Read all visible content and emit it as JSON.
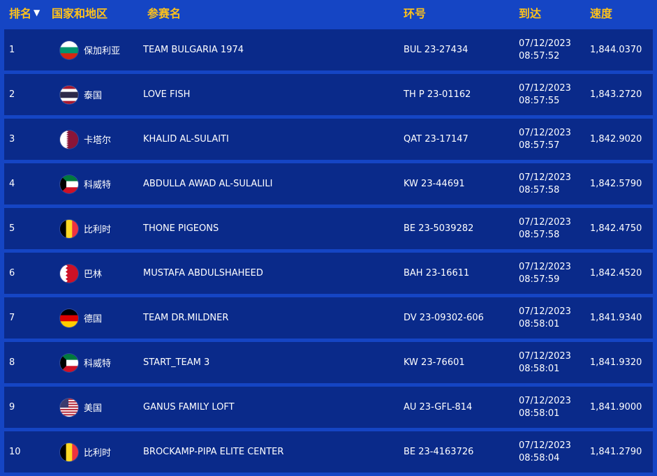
{
  "headers": {
    "rank": "排名",
    "country": "国家和地区",
    "name": "参赛名",
    "ring": "环号",
    "arrival": "到达",
    "speed": "速度"
  },
  "rows": [
    {
      "rank": "1",
      "country": "保加利亚",
      "flag": "bulgaria-flag-icon",
      "name": "TEAM BULGARIA 1974",
      "ring": "BUL 23-27434",
      "date": "07/12/2023",
      "time": "08:57:52",
      "speed": "1,844.0370"
    },
    {
      "rank": "2",
      "country": "泰国",
      "flag": "thailand-flag-icon",
      "name": "LOVE FISH",
      "ring": "TH P 23-01162",
      "date": "07/12/2023",
      "time": "08:57:55",
      "speed": "1,843.2720"
    },
    {
      "rank": "3",
      "country": "卡塔尔",
      "flag": "qatar-flag-icon",
      "name": "KHALID AL-SULAITI",
      "ring": "QAT 23-17147",
      "date": "07/12/2023",
      "time": "08:57:57",
      "speed": "1,842.9020"
    },
    {
      "rank": "4",
      "country": "科威特",
      "flag": "kuwait-flag-icon",
      "name": "ABDULLA AWAD AL-SULALILI",
      "ring": "KW 23-44691",
      "date": "07/12/2023",
      "time": "08:57:58",
      "speed": "1,842.5790"
    },
    {
      "rank": "5",
      "country": "比利时",
      "flag": "belgium-flag-icon",
      "name": "THONE PIGEONS",
      "ring": "BE 23-5039282",
      "date": "07/12/2023",
      "time": "08:57:58",
      "speed": "1,842.4750"
    },
    {
      "rank": "6",
      "country": "巴林",
      "flag": "bahrain-flag-icon",
      "name": "MUSTAFA ABDULSHAHEED",
      "ring": "BAH 23-16611",
      "date": "07/12/2023",
      "time": "08:57:59",
      "speed": "1,842.4520"
    },
    {
      "rank": "7",
      "country": "德国",
      "flag": "germany-flag-icon",
      "name": "TEAM DR.MILDNER",
      "ring": "DV 23-09302-606",
      "date": "07/12/2023",
      "time": "08:58:01",
      "speed": "1,841.9340"
    },
    {
      "rank": "8",
      "country": "科威特",
      "flag": "kuwait-flag-icon",
      "name": "START_TEAM 3",
      "ring": "KW 23-76601",
      "date": "07/12/2023",
      "time": "08:58:01",
      "speed": "1,841.9320"
    },
    {
      "rank": "9",
      "country": "美国",
      "flag": "usa-flag-icon",
      "name": "GANUS FAMILY LOFT",
      "ring": "AU 23-GFL-814",
      "date": "07/12/2023",
      "time": "08:58:01",
      "speed": "1,841.9000"
    },
    {
      "rank": "10",
      "country": "比利时",
      "flag": "belgium-flag-icon",
      "name": "BROCKAMP-PIPA ELITE CENTER",
      "ring": "BE 23-4163726",
      "date": "07/12/2023",
      "time": "08:58:04",
      "speed": "1,841.2790"
    }
  ],
  "colors": {
    "background": "#1545c4",
    "row_background": "#0a2a8a",
    "header_text": "#ffc21a"
  }
}
